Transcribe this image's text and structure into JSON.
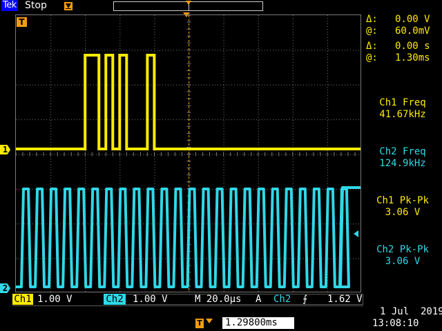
{
  "topbar": {
    "brand": "Tek",
    "run_state": "Stop"
  },
  "markers": {
    "ch1": "1",
    "ch2": "2",
    "trigger": "T"
  },
  "cursors": {
    "delta_v_label": "Δ:",
    "delta_v_value": "0.00 V",
    "at_v_label": "@:",
    "at_v_value": "60.0mV",
    "delta_t_label": "Δ:",
    "delta_t_value": "0.00 s",
    "at_t_label": "@:",
    "at_t_value": "1.30ms"
  },
  "measurements": [
    {
      "label": "Ch1 Freq",
      "value": "41.67kHz",
      "channel": "ch1"
    },
    {
      "label": "Ch2 Freq",
      "value": "124.9kHz",
      "channel": "ch2"
    },
    {
      "label": "Ch1 Pk-Pk",
      "value": "3.06 V",
      "channel": "ch1"
    },
    {
      "label": "Ch2 Pk-Pk",
      "value": "3.06 V",
      "channel": "ch2"
    }
  ],
  "status": {
    "ch1_label": "Ch1",
    "ch1_scale": "1.00 V",
    "ch2_label": "Ch2",
    "ch2_scale": "1.00 V",
    "timebase": "M 20.0µs",
    "trigger_mode": "A",
    "trigger_source": "Ch2",
    "trigger_slope": "⨍",
    "trigger_level": "1.62 V",
    "delay_icon": "T",
    "delay_value": "1.29800ms",
    "date": "1 Jul  2019",
    "time": "13:08:10"
  },
  "colors": {
    "ch1": "#ffeb00",
    "ch2": "#2fd8e8",
    "trigger": "#f39c12",
    "grid": "#7a7a7a"
  },
  "waveforms": {
    "ch1_pulses_divisions": [
      [
        2.0,
        2.4
      ],
      [
        2.6,
        2.8
      ],
      [
        3.0,
        3.2
      ],
      [
        3.8,
        4.0
      ]
    ],
    "ch2_period_divisions": 0.4
  }
}
